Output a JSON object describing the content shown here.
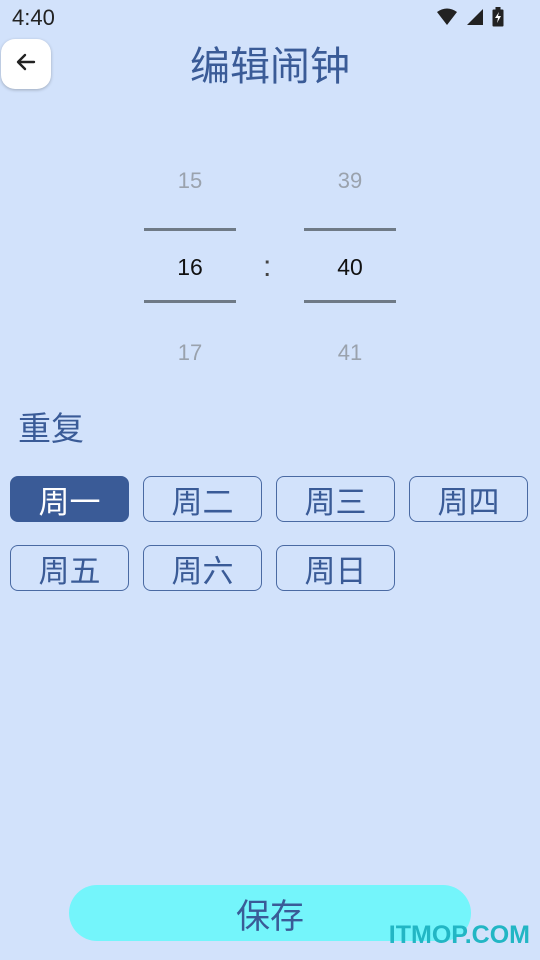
{
  "status_bar": {
    "time": "4:40",
    "icons": [
      "wifi-icon",
      "signal-icon",
      "battery-charging-icon"
    ]
  },
  "header": {
    "title": "编辑闹钟",
    "back_icon": "arrow-left-icon"
  },
  "time_picker": {
    "hour": {
      "prev": "15",
      "selected": "16",
      "next": "17"
    },
    "separator": ":",
    "minute": {
      "prev": "39",
      "selected": "40",
      "next": "41"
    }
  },
  "repeat": {
    "label": "重复",
    "days": [
      {
        "label": "周一",
        "selected": true
      },
      {
        "label": "周二",
        "selected": false
      },
      {
        "label": "周三",
        "selected": false
      },
      {
        "label": "周四",
        "selected": false
      },
      {
        "label": "周五",
        "selected": false
      },
      {
        "label": "周六",
        "selected": false
      },
      {
        "label": "周日",
        "selected": false
      }
    ]
  },
  "save_label": "保存",
  "watermark": "ITMOP.COM",
  "colors": {
    "background": "#d2e2fb",
    "accent": "#3a5b97",
    "save_button": "#74f5fb",
    "watermark": "#22b6c4"
  }
}
